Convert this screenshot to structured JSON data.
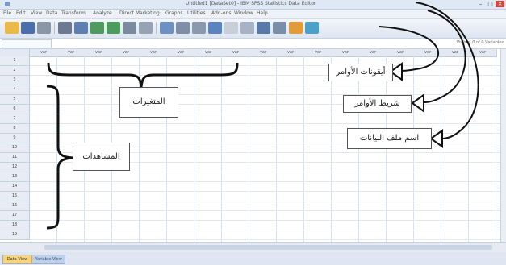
{
  "window": {
    "title": "Untitled1 [DataSet0] - IBM SPSS Statistics Data Editor"
  },
  "menu": [
    "File",
    "Edit",
    "View",
    "Data",
    "Transform",
    "Analyze",
    "Direct Marketing",
    "Graphs",
    "Utilities",
    "Add-ons",
    "Window",
    "Help"
  ],
  "toolbar": {
    "icons": [
      "open-icon",
      "save-icon",
      "print-icon",
      "cut-icon",
      "copy-icon",
      "undo-icon",
      "redo-icon",
      "goto-case-icon",
      "variables-icon",
      "find-icon",
      "insert-cases-icon",
      "insert-variable-icon",
      "split-file-icon",
      "weight-icon",
      "select-cases-icon",
      "value-labels-icon",
      "use-sets-icon",
      "spell-icon",
      "chart-icon"
    ]
  },
  "cell_editor": {
    "visible_label": "Visible: 0 of 0 Variables"
  },
  "grid": {
    "column_headers": [
      "var",
      "var",
      "var",
      "var",
      "var",
      "var",
      "var",
      "var",
      "var",
      "var",
      "var",
      "var",
      "var",
      "var",
      "var",
      "var",
      "var"
    ],
    "row_numbers": [
      "1",
      "2",
      "3",
      "4",
      "5",
      "6",
      "7",
      "8",
      "9",
      "10",
      "11",
      "12",
      "13",
      "14",
      "15",
      "16",
      "17",
      "18",
      "19"
    ]
  },
  "tabs": {
    "data_view": "Data View",
    "variable_view": "Variable View"
  },
  "annotations": {
    "toolbar_icons": "أيقونات الأوامر",
    "menu_bar": "شريط الأوامر",
    "file_name": "اسم ملف البيانات",
    "variables": "المتغيرات",
    "cases": "المشاهدات"
  },
  "colors": {
    "accent": "#f7d37a",
    "annotation_line": "#111111"
  }
}
